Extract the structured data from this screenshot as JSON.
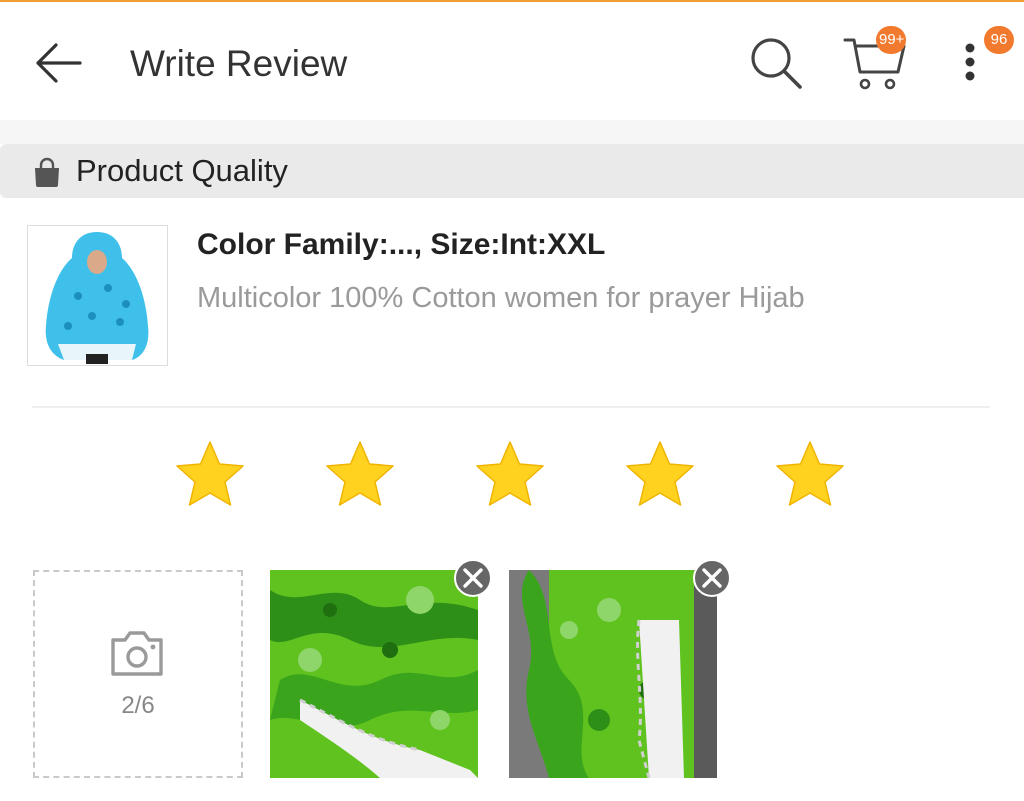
{
  "header": {
    "title": "Write Review",
    "cart_badge": "99+",
    "more_badge": "96"
  },
  "section": {
    "title": "Product Quality"
  },
  "product": {
    "variant": "Color Family:..., Size:Int:XXL",
    "name": "Multicolor 100% Cotton women for prayer Hijab"
  },
  "rating": {
    "value": 5,
    "max": 5
  },
  "upload": {
    "count": "2/6"
  },
  "colors": {
    "accent": "#f27a2e",
    "star": "#ffd21f",
    "muted": "#9a9a9a"
  },
  "icons": [
    "back-arrow-icon",
    "search-icon",
    "cart-icon",
    "more-vert-icon",
    "shopping-bag-icon",
    "star-icon",
    "camera-icon",
    "close-icon"
  ]
}
